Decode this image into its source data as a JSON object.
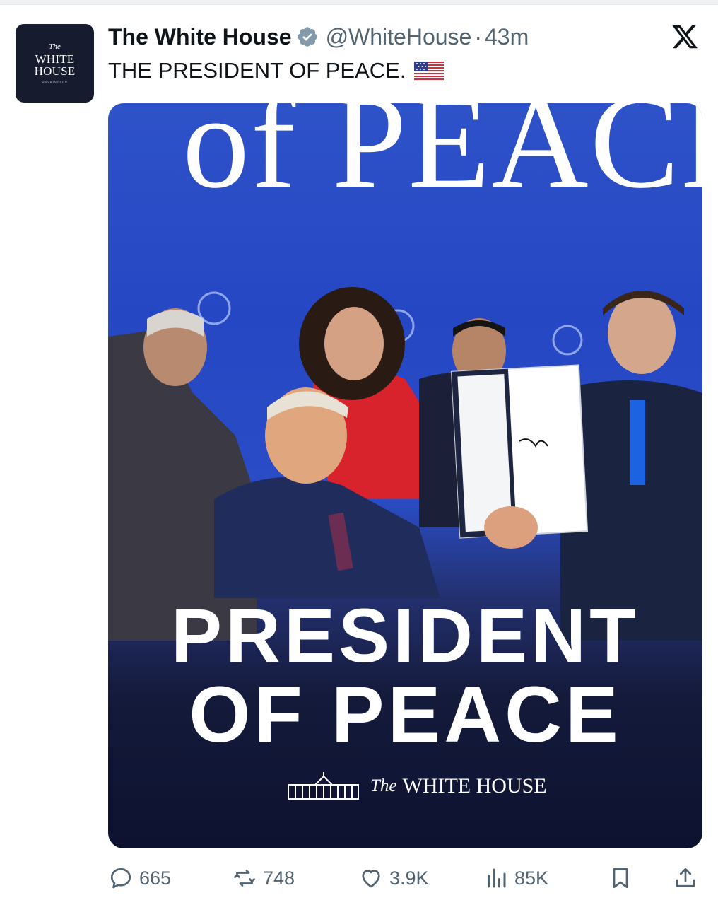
{
  "tweet": {
    "author": {
      "display_name": "The White House",
      "handle": "@WhiteHouse",
      "separator": "·",
      "time": "43m",
      "avatar": {
        "line_the": "The",
        "line_1": "WHITE",
        "line_2": "HOUSE",
        "small": "WASHINGTON"
      }
    },
    "text": "THE PRESIDENT OF PEACE.",
    "emoji": "flag-us",
    "platform_icon": "x-logo-icon",
    "media": {
      "backdrop_text": "of PEACE",
      "headline_line1": "PRESIDENT",
      "headline_line2": "OF PEACE",
      "watermark_the": "The",
      "watermark_name": "WHITE HOUSE"
    },
    "actions": {
      "replies": "665",
      "reposts": "748",
      "likes": "3.9K",
      "views": "85K"
    },
    "colors": {
      "accent": "#1d9bf0",
      "verified_badge": "#829aab",
      "muted_text": "#536471",
      "media_blue": "#2a4dc6",
      "media_navy": "#0d1230"
    }
  }
}
